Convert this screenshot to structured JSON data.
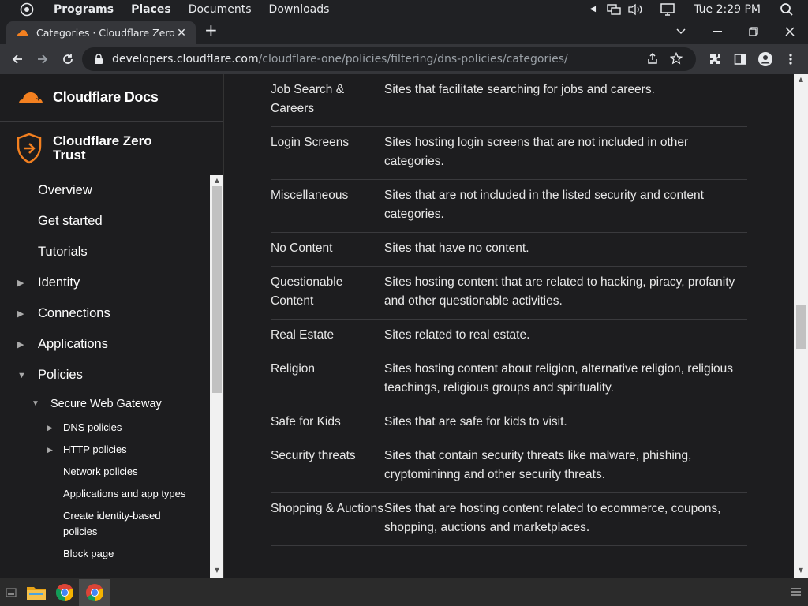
{
  "os": {
    "menus": [
      "Programs",
      "Places",
      "Documents",
      "Downloads"
    ],
    "clock": "Tue 2:29 PM"
  },
  "browser": {
    "tab_title": "Categories · Cloudflare Zero Trus",
    "url_host": "developers.cloudflare.com",
    "url_path": "/cloudflare-one/policies/filtering/dns-policies/categories/"
  },
  "sidebar": {
    "brand": "Cloudflare Docs",
    "product": "Cloudflare Zero Trust",
    "items": [
      {
        "label": "Overview",
        "arrow": ""
      },
      {
        "label": "Get started",
        "arrow": ""
      },
      {
        "label": "Tutorials",
        "arrow": ""
      },
      {
        "label": "Identity",
        "arrow": "▶"
      },
      {
        "label": "Connections",
        "arrow": "▶"
      },
      {
        "label": "Applications",
        "arrow": "▶"
      },
      {
        "label": "Policies",
        "arrow": "▼"
      }
    ],
    "sub": {
      "label": "Secure Web Gateway",
      "arrow": "▼"
    },
    "sub2": [
      {
        "label": "DNS policies",
        "arrow": "▶"
      },
      {
        "label": "HTTP policies",
        "arrow": "▶"
      },
      {
        "label": "Network policies",
        "arrow": ""
      },
      {
        "label": "Applications and app types",
        "arrow": ""
      },
      {
        "label": "Create identity-based policies",
        "arrow": ""
      },
      {
        "label": "Block page",
        "arrow": ""
      }
    ]
  },
  "categories": [
    {
      "name": "Job Search & Careers",
      "desc": "Sites that facilitate searching for jobs and careers."
    },
    {
      "name": "Login Screens",
      "desc": "Sites hosting login screens that are not included in other categories."
    },
    {
      "name": "Miscellaneous",
      "desc": "Sites that are not included in the listed security and content categories."
    },
    {
      "name": "No Content",
      "desc": "Sites that have no content."
    },
    {
      "name": "Questionable Content",
      "desc": "Sites hosting content that are related to hacking, piracy, profanity and other questionable activities."
    },
    {
      "name": "Real Estate",
      "desc": "Sites related to real estate."
    },
    {
      "name": "Religion",
      "desc": "Sites hosting content about religion, alternative religion, religious teachings, religious groups and spirituality."
    },
    {
      "name": "Safe for Kids",
      "desc": "Sites that are safe for kids to visit."
    },
    {
      "name": "Security threats",
      "desc": "Sites that contain security threats like malware, phishing, cryptomininng and other security threats."
    },
    {
      "name": "Shopping & Auctions",
      "desc": "Sites that are hosting content related to ecommerce, coupons, shopping, auctions and marketplaces."
    }
  ],
  "colors": {
    "accent": "#f38020",
    "bg": "#1d1d1f"
  }
}
